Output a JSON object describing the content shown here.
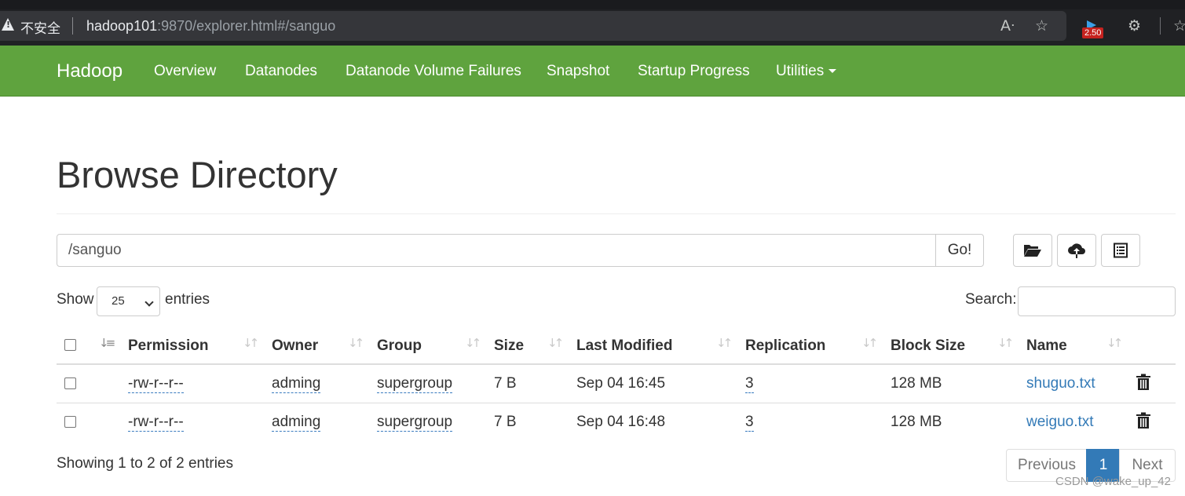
{
  "browser": {
    "security_label": "不安全",
    "url_host": "hadoop101",
    "url_rest": ":9870/explorer.html#/sanguo",
    "badge_count": "2.50"
  },
  "navbar": {
    "brand": "Hadoop",
    "items": [
      "Overview",
      "Datanodes",
      "Datanode Volume Failures",
      "Snapshot",
      "Startup Progress",
      "Utilities"
    ]
  },
  "page": {
    "title": "Browse Directory",
    "path_value": "/sanguo",
    "go_label": "Go!",
    "show_label": "Show",
    "entries_label": "entries",
    "page_size": "25",
    "search_label": "Search:"
  },
  "table": {
    "columns": [
      "Permission",
      "Owner",
      "Group",
      "Size",
      "Last Modified",
      "Replication",
      "Block Size",
      "Name"
    ],
    "rows": [
      {
        "permission": "-rw-r--r--",
        "owner": "adming",
        "group": "supergroup",
        "size": "7 B",
        "modified": "Sep 04 16:45",
        "replication": "3",
        "block_size": "128 MB",
        "name": "shuguo.txt"
      },
      {
        "permission": "-rw-r--r--",
        "owner": "adming",
        "group": "supergroup",
        "size": "7 B",
        "modified": "Sep 04 16:48",
        "replication": "3",
        "block_size": "128 MB",
        "name": "weiguo.txt"
      }
    ]
  },
  "footer": {
    "info": "Showing 1 to 2 of 2 entries",
    "previous": "Previous",
    "current_page": "1",
    "next": "Next"
  },
  "watermark": "CSDN @wake_up_42",
  "colors": {
    "navbar": "#5fa33e",
    "link": "#337ab7",
    "active_page": "#337ab7"
  }
}
